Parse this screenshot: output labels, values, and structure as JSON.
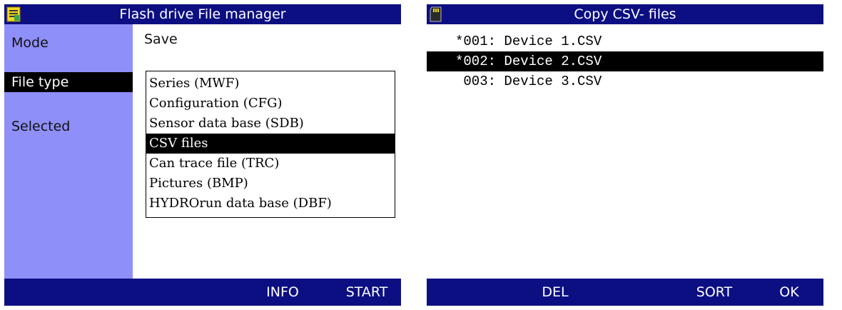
{
  "left_screen": {
    "title": "Flash drive File manager",
    "title_icon": "file-manager-icon",
    "sidebar": {
      "items": [
        {
          "label": "Mode",
          "selected": false
        },
        {
          "label": "File type",
          "selected": true
        },
        {
          "label": "Selected",
          "selected": false
        }
      ]
    },
    "mode_value": "Save",
    "file_types": [
      {
        "label": "Series (MWF)",
        "selected": false
      },
      {
        "label": "Configuration (CFG)",
        "selected": false
      },
      {
        "label": "Sensor data base (SDB)",
        "selected": false
      },
      {
        "label": "CSV files",
        "selected": true
      },
      {
        "label": "Can trace file (TRC)",
        "selected": false
      },
      {
        "label": "Pictures (BMP)",
        "selected": false
      },
      {
        "label": "HYDROrun data base (DBF)",
        "selected": false
      }
    ],
    "footer": {
      "info_label": "INFO",
      "start_label": "START"
    }
  },
  "right_screen": {
    "title": "Copy CSV- files",
    "title_icon": "sd-card-icon",
    "files": [
      {
        "label": "*001: Device 1.CSV",
        "selected": false
      },
      {
        "label": "*002: Device 2.CSV",
        "selected": true
      },
      {
        "label": " 003: Device 3.CSV",
        "selected": false
      }
    ],
    "footer": {
      "del_label": "DEL",
      "sort_label": "SORT",
      "ok_label": "OK"
    }
  },
  "colors": {
    "bar_blue": "#0c0f82",
    "sidebar_lavender": "#8f8ff9",
    "selection": "#000000",
    "icon_yellow": "#f2d820",
    "icon_green": "#3fa34a"
  }
}
